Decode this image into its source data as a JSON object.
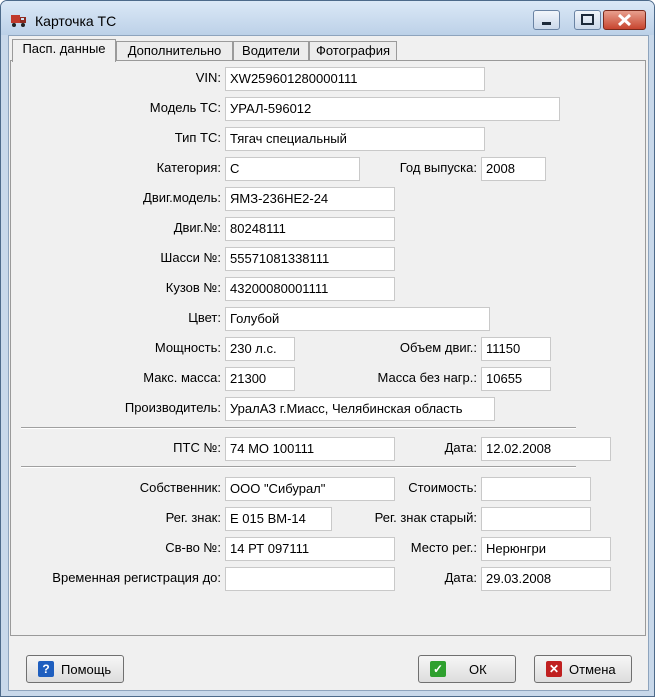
{
  "window": {
    "title": "Карточка ТС",
    "icon": "truck-icon",
    "controls": [
      "minimize-icon",
      "maximize-icon",
      "close-icon"
    ]
  },
  "tabs": [
    {
      "label": "Пасп. данные",
      "active": true
    },
    {
      "label": "Дополнительно",
      "active": false
    },
    {
      "label": "Водители",
      "active": false
    },
    {
      "label": "Фотография",
      "active": false
    }
  ],
  "form": {
    "vin": {
      "label": "VIN:",
      "value": "XW259601280000111"
    },
    "model": {
      "label": "Модель ТС:",
      "value": "УРАЛ-596012"
    },
    "type": {
      "label": "Тип ТС:",
      "value": "Тягач специальный"
    },
    "category": {
      "label": "Категория:",
      "value": "С"
    },
    "year": {
      "label": "Год выпуска:",
      "value": "2008"
    },
    "engine_model": {
      "label": "Двиг.модель:",
      "value": "ЯМЗ-236НЕ2-24"
    },
    "engine_no": {
      "label": "Двиг.№:",
      "value": "80248111"
    },
    "chassis_no": {
      "label": "Шасси №:",
      "value": "55571081338111"
    },
    "body_no": {
      "label": "Кузов №:",
      "value": "43200080001111"
    },
    "color": {
      "label": "Цвет:",
      "value": "Голубой"
    },
    "power": {
      "label": "Мощность:",
      "value": "230 л.с."
    },
    "engine_volume": {
      "label": "Объем двиг.:",
      "value": "11150"
    },
    "max_mass": {
      "label": "Макс. масса:",
      "value": "21300"
    },
    "unladen_mass": {
      "label": "Масса без нагр.:",
      "value": "10655"
    },
    "manufacturer": {
      "label": "Производитель:",
      "value": "УралАЗ г.Миасс, Челябинская область"
    },
    "pts_no": {
      "label": "ПТС №:",
      "value": "74 МО 100111"
    },
    "pts_date": {
      "label": "Дата:",
      "value": "12.02.2008"
    },
    "owner": {
      "label": "Собственник:",
      "value": "ООО \"Сибурал\""
    },
    "cost": {
      "label": "Стоимость:",
      "value": ""
    },
    "reg_sign": {
      "label": "Рег. знак:",
      "value": "Е 015 ВМ-14"
    },
    "old_reg_sign": {
      "label": "Рег. знак старый:",
      "value": ""
    },
    "certificate_no": {
      "label": "Св-во №:",
      "value": "14 РТ 097111"
    },
    "reg_place": {
      "label": "Место рег.:",
      "value": "Нерюнгри"
    },
    "temp_reg_until": {
      "label": "Временная регистрация до:",
      "value": ""
    },
    "reg_date": {
      "label": "Дата:",
      "value": "29.03.2008"
    }
  },
  "buttons": {
    "help": {
      "label": "Помощь",
      "icon": "help-icon",
      "icon_color": "#1f5fbf"
    },
    "ok": {
      "label": "ОК",
      "icon": "check-icon",
      "icon_color": "#2ea02e"
    },
    "cancel": {
      "label": "Отмена",
      "icon": "cancel-icon",
      "icon_color": "#c02020"
    }
  }
}
